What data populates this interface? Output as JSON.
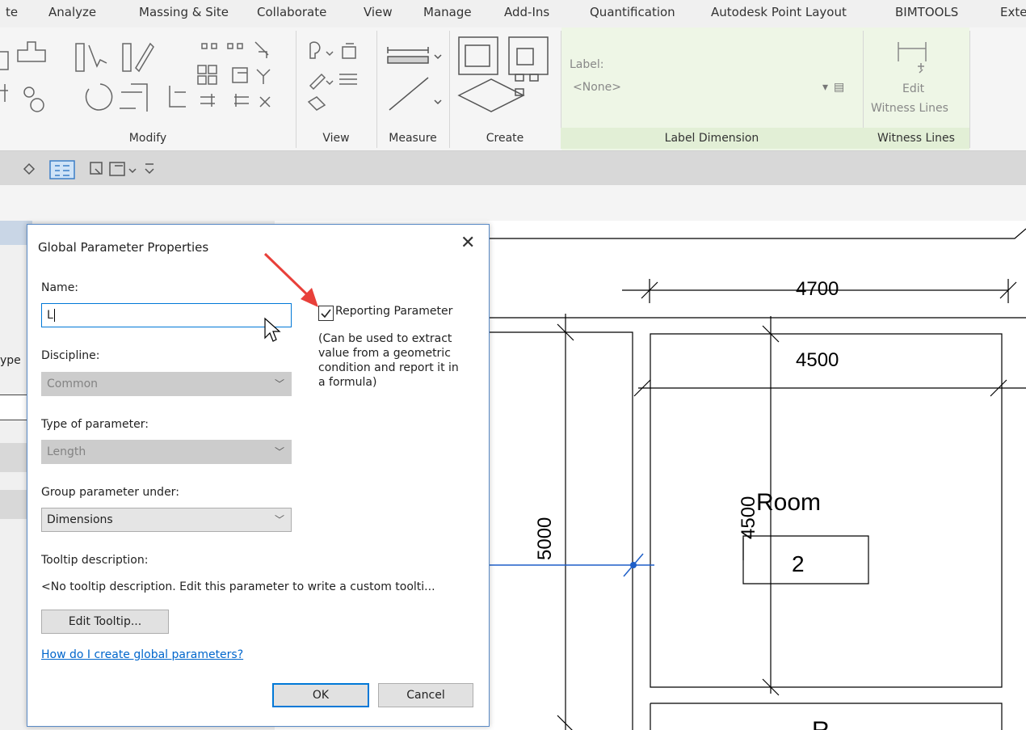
{
  "menu": [
    "te",
    "Analyze",
    "Massing & Site",
    "Collaborate",
    "View",
    "Manage",
    "Add-Ins",
    "Quantification",
    "Autodesk Point Layout",
    "BIMTOOLS",
    "Exte"
  ],
  "ribbon": {
    "panels": {
      "modify": "Modify",
      "view": "View",
      "measure": "Measure",
      "create": "Create",
      "label_dimension": "Label Dimension",
      "witness_lines": "Witness Lines"
    },
    "label_caption": "Label:",
    "label_value": "<None>",
    "edit_witness_lines": "Edit",
    "edit_witness_lines_2": "Witness Lines"
  },
  "props_partial_text": "ype",
  "dialog": {
    "title": "Global Parameter Properties",
    "name_label": "Name:",
    "name_value": "L",
    "reporting_label": "Reporting Parameter",
    "reporting_checked": true,
    "reporting_note": [
      "(Can be used to extract",
      "value from a geometric",
      "condition and report it in",
      "a formula)"
    ],
    "discipline_label": "Discipline:",
    "discipline_value": "Common",
    "type_label": "Type of parameter:",
    "type_value": "Length",
    "group_label": "Group parameter under:",
    "group_value": "Dimensions",
    "tooltip_label": "Tooltip description:",
    "tooltip_text": "<No tooltip description. Edit this parameter to write a custom toolti...",
    "edit_tooltip_button": "Edit Tooltip...",
    "help_link": "How do I create global parameters?",
    "ok_button": "OK",
    "cancel_button": "Cancel"
  },
  "drawing": {
    "dim_top": "4700",
    "dim_room_width": "4500",
    "dim_vertical": "5000",
    "dim_room_height": "4500",
    "room_name": "Room",
    "room_number": "2",
    "room_name_partial": "R"
  },
  "colors": {
    "accent_blue": "#0078d7",
    "dim_line_blue": "#1e5fc8",
    "annotation_red": "#e8403a",
    "label_panel_green": "#eef6e6"
  }
}
